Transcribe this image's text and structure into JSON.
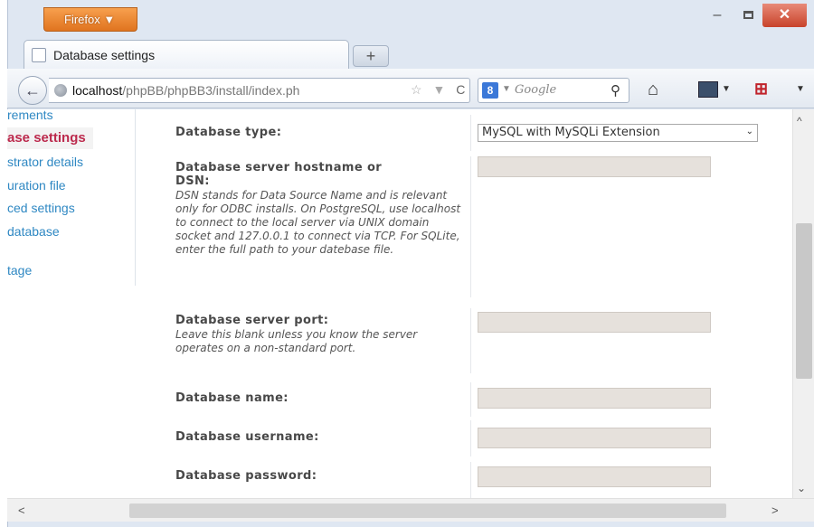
{
  "browser": {
    "menu_button": "Firefox ▼",
    "window_controls": {
      "minimize": "–",
      "close": "✕"
    },
    "tab": {
      "title": "Database settings"
    },
    "new_tab": "+",
    "back": "←",
    "url": {
      "host": "localhost",
      "path": "/phpBB/phpBB3/install/index.ph"
    },
    "url_icons": "☆ ▼",
    "reload": "C",
    "search": {
      "engine_icon": "8",
      "dropdown": "▼",
      "placeholder": "Google",
      "go": "⚲"
    },
    "icons": {
      "home": "home-icon",
      "bookmarks": "bookmarks-icon",
      "pdf": "pdf-icon"
    },
    "toolbar_glyphs": {
      "home": "⌂",
      "dropdown": "▼",
      "pdf": "⊞"
    }
  },
  "sidebar": {
    "items": [
      {
        "label": "rements",
        "active": false
      },
      {
        "label": "ase settings",
        "active": true
      },
      {
        "label": "strator details",
        "active": false
      },
      {
        "label": "uration file",
        "active": false
      },
      {
        "label": "ced settings",
        "active": false
      },
      {
        "label": " database",
        "active": false
      },
      {
        "label": "tage",
        "active": false
      }
    ]
  },
  "form": {
    "db_type": {
      "label": "Database type:",
      "selected": "MySQL with MySQLi Extension",
      "arrow": "⌄"
    },
    "hostname": {
      "label_line1": "Database server hostname or",
      "label_line2": "DSN:",
      "explain": "DSN stands for Data Source Name and is relevant only for ODBC installs. On PostgreSQL, use localhost to connect to the local server via UNIX domain socket and 127.0.0.1 to connect via TCP. For SQLite, enter the full path to your datebase file.",
      "value": ""
    },
    "port": {
      "label": "Database server port:",
      "explain": "Leave this blank unless you know the server operates on a non-standard port.",
      "value": ""
    },
    "name": {
      "label": "Database name:",
      "value": ""
    },
    "username": {
      "label": "Database username:",
      "value": ""
    },
    "password": {
      "label": "Database password:",
      "value": ""
    }
  },
  "scrollbars": {
    "up": "^",
    "down": "⌄",
    "left": "<",
    "right": ">"
  }
}
